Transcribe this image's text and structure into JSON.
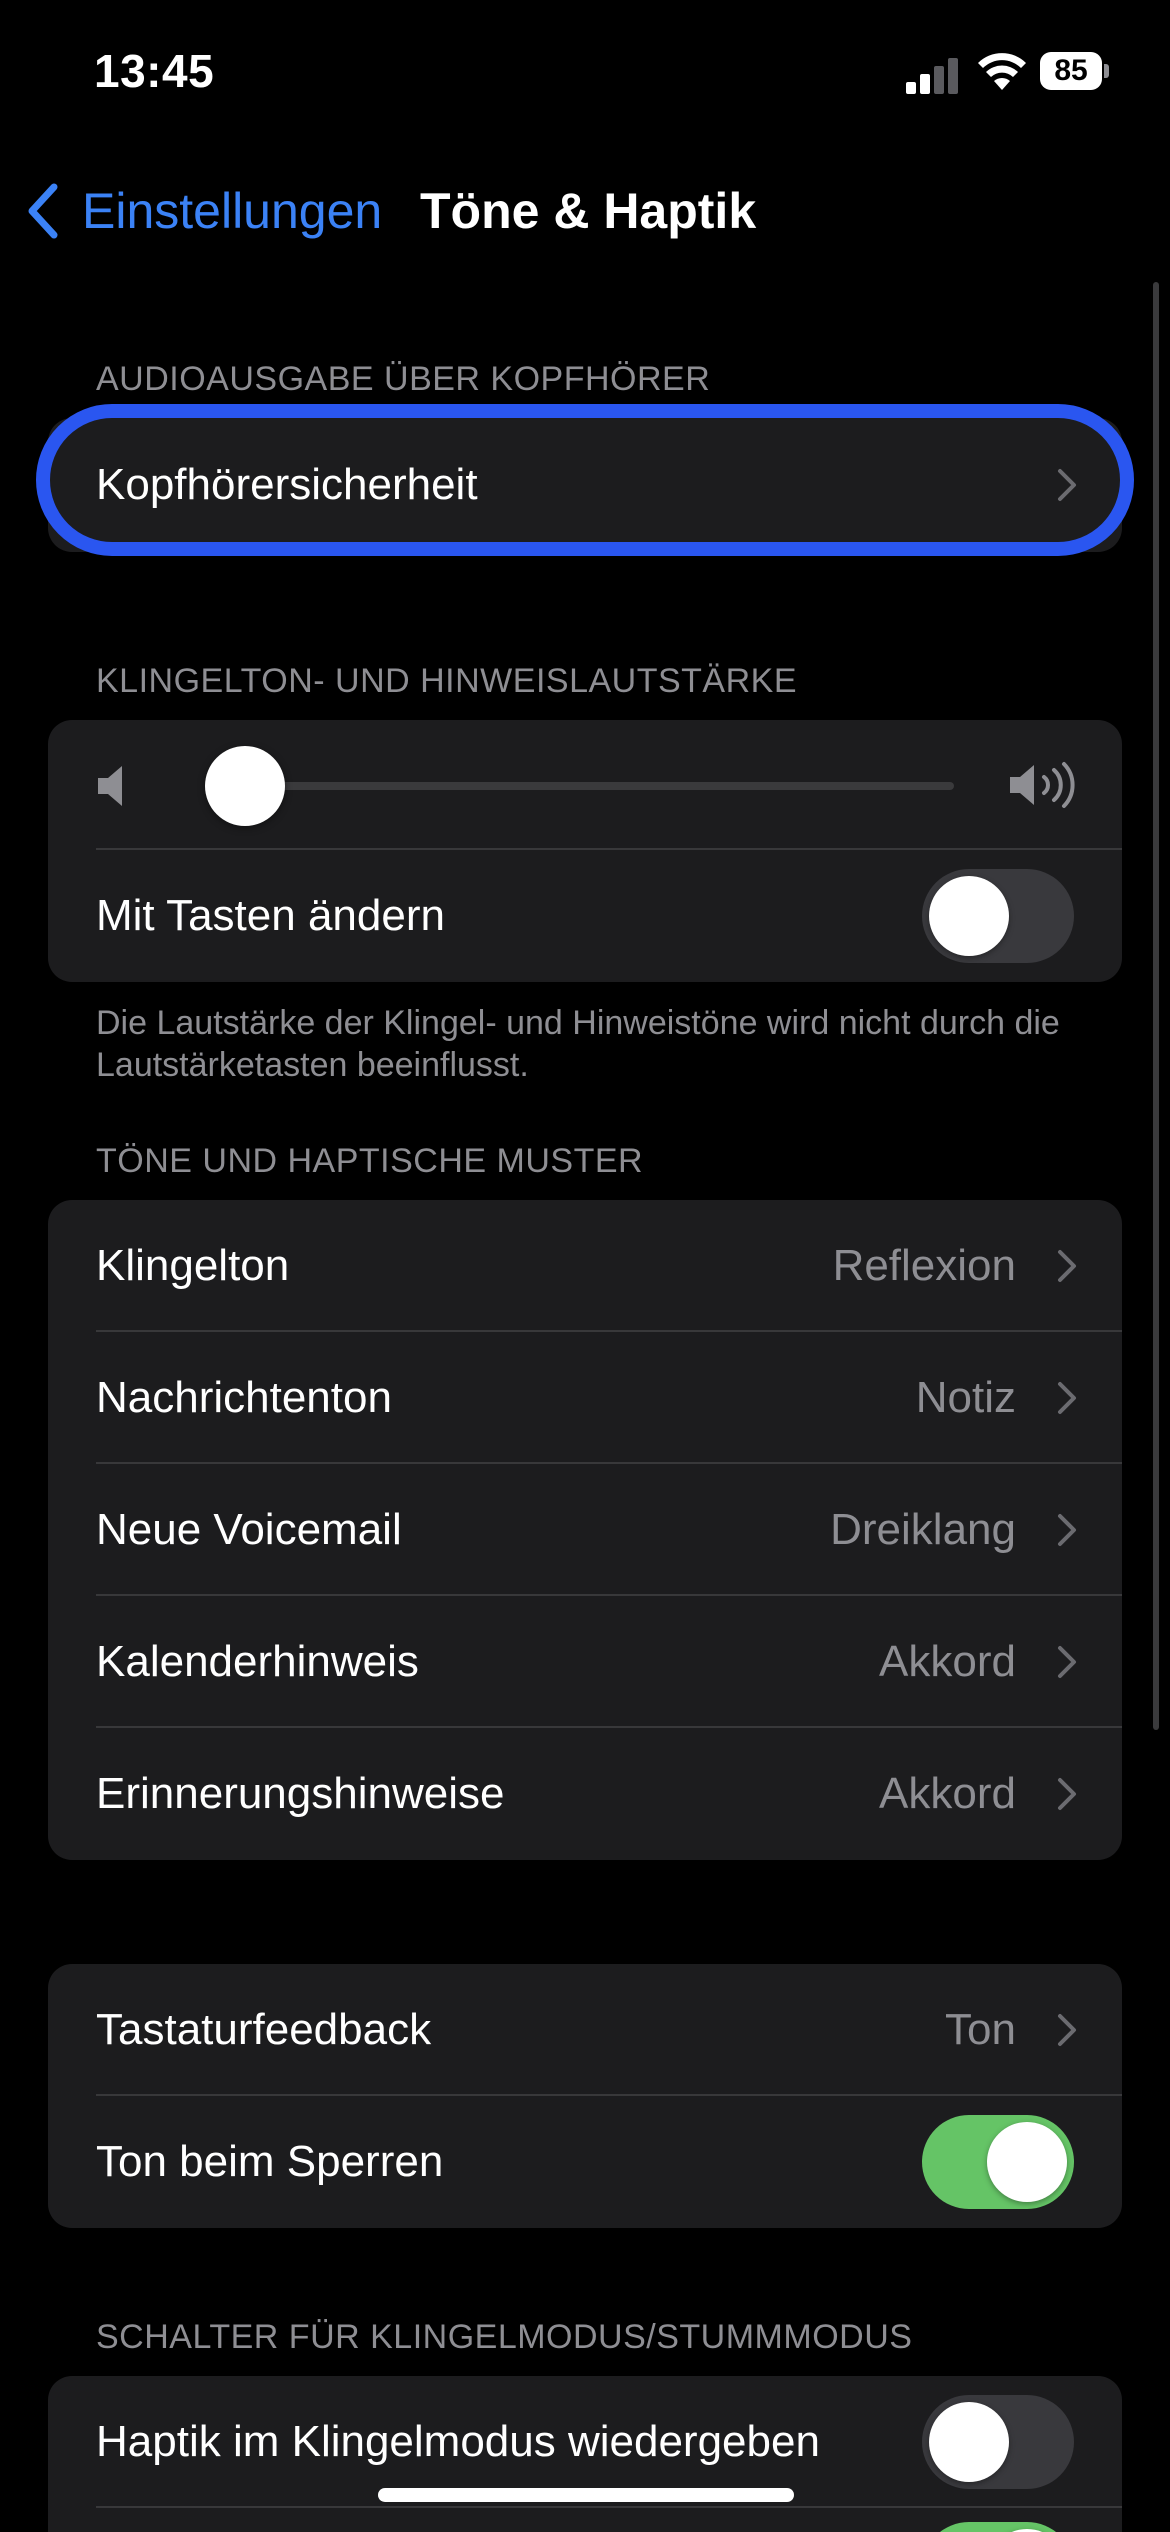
{
  "status_bar": {
    "time": "13:45",
    "battery": "85",
    "signal_bars_active": 2,
    "signal_bars_total": 4
  },
  "nav": {
    "back_label": "Einstellungen",
    "title": "Töne & Haptik"
  },
  "sections": {
    "headphone": {
      "header": "AUDIOAUSGABE ÜBER KOPFHÖRER",
      "row_label": "Kopfhörersicherheit"
    },
    "volume": {
      "header": "KLINGELTON- UND HINWEISLAUTSTÄRKE",
      "slider_level": 0.05,
      "toggle_label": "Mit Tasten ändern",
      "toggle_on": false,
      "footer": "Die Lautstärke der Klingel- und Hinweistöne wird nicht durch die Lautstärketasten beeinflusst."
    },
    "tones": {
      "header": "TÖNE UND HAPTISCHE MUSTER",
      "rows": [
        {
          "label": "Klingelton",
          "value": "Reflexion"
        },
        {
          "label": "Nachrichtenton",
          "value": "Notiz"
        },
        {
          "label": "Neue Voicemail",
          "value": "Dreiklang"
        },
        {
          "label": "Kalenderhinweis",
          "value": "Akkord"
        },
        {
          "label": "Erinnerungshinweise",
          "value": "Akkord"
        }
      ]
    },
    "feedback": {
      "keyboard_label": "Tastaturfeedback",
      "keyboard_value": "Ton",
      "lock_label": "Ton beim Sperren",
      "lock_on": true
    },
    "switch": {
      "header": "SCHALTER FÜR KLINGELMODUS/STUMMMODUS",
      "haptic_ring_label": "Haptik im Klingelmodus wiedergeben",
      "haptic_ring_on": false
    }
  },
  "colors": {
    "accent": "#3b82f6",
    "highlight_ring": "#2a56f0",
    "toggle_on": "#65c466",
    "toggle_off": "#39393d",
    "group_bg": "#1c1c1e",
    "secondary_text": "#8e8e93"
  }
}
